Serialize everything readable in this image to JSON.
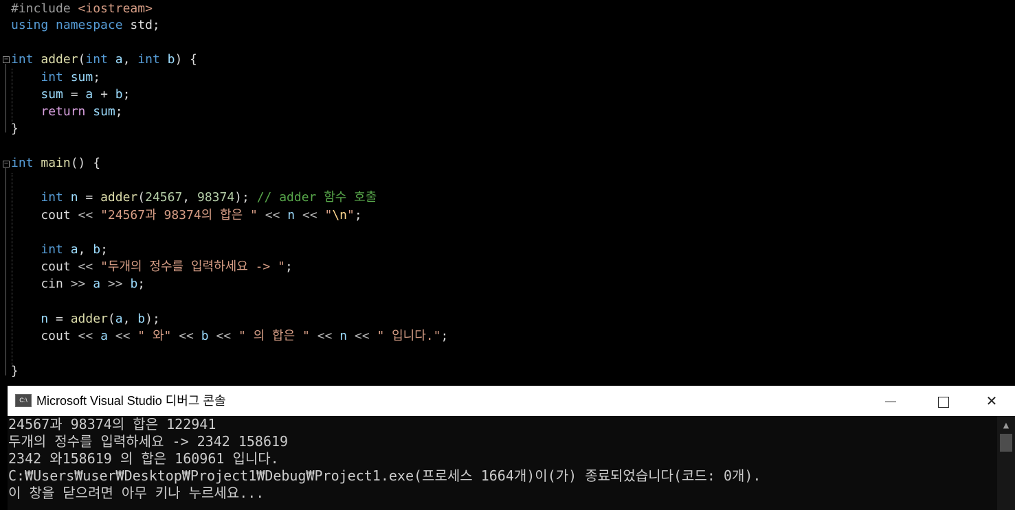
{
  "editor": {
    "lines": [
      [
        {
          "c": "tk-pre",
          "t": "#include "
        },
        {
          "c": "tk-str",
          "t": "<iostream>"
        }
      ],
      [
        {
          "c": "tk-kw",
          "t": "using"
        },
        {
          "c": "tk-txt",
          "t": " "
        },
        {
          "c": "tk-kw",
          "t": "namespace"
        },
        {
          "c": "tk-txt",
          "t": " std;"
        }
      ],
      [],
      [
        {
          "c": "tk-kw",
          "t": "int"
        },
        {
          "c": "tk-txt",
          "t": " "
        },
        {
          "c": "tk-fn",
          "t": "adder"
        },
        {
          "c": "tk-txt",
          "t": "("
        },
        {
          "c": "tk-kw",
          "t": "int"
        },
        {
          "c": "tk-txt",
          "t": " "
        },
        {
          "c": "tk-par",
          "t": "a"
        },
        {
          "c": "tk-txt",
          "t": ", "
        },
        {
          "c": "tk-kw",
          "t": "int"
        },
        {
          "c": "tk-txt",
          "t": " "
        },
        {
          "c": "tk-par",
          "t": "b"
        },
        {
          "c": "tk-txt",
          "t": ") {"
        }
      ],
      [
        {
          "c": "tk-txt",
          "t": "    "
        },
        {
          "c": "tk-kw",
          "t": "int"
        },
        {
          "c": "tk-txt",
          "t": " "
        },
        {
          "c": "tk-var",
          "t": "sum"
        },
        {
          "c": "tk-txt",
          "t": ";"
        }
      ],
      [
        {
          "c": "tk-txt",
          "t": "    "
        },
        {
          "c": "tk-var",
          "t": "sum"
        },
        {
          "c": "tk-txt",
          "t": " = "
        },
        {
          "c": "tk-par",
          "t": "a"
        },
        {
          "c": "tk-txt",
          "t": " + "
        },
        {
          "c": "tk-par",
          "t": "b"
        },
        {
          "c": "tk-txt",
          "t": ";"
        }
      ],
      [
        {
          "c": "tk-txt",
          "t": "    "
        },
        {
          "c": "tk-ctl",
          "t": "return"
        },
        {
          "c": "tk-txt",
          "t": " "
        },
        {
          "c": "tk-var",
          "t": "sum"
        },
        {
          "c": "tk-txt",
          "t": ";"
        }
      ],
      [
        {
          "c": "tk-txt",
          "t": "}"
        }
      ],
      [],
      [
        {
          "c": "tk-kw",
          "t": "int"
        },
        {
          "c": "tk-txt",
          "t": " "
        },
        {
          "c": "tk-fn",
          "t": "main"
        },
        {
          "c": "tk-txt",
          "t": "() {"
        }
      ],
      [],
      [
        {
          "c": "tk-txt",
          "t": "    "
        },
        {
          "c": "tk-kw",
          "t": "int"
        },
        {
          "c": "tk-txt",
          "t": " "
        },
        {
          "c": "tk-var",
          "t": "n"
        },
        {
          "c": "tk-txt",
          "t": " = "
        },
        {
          "c": "tk-fn",
          "t": "adder"
        },
        {
          "c": "tk-txt",
          "t": "("
        },
        {
          "c": "tk-num",
          "t": "24567"
        },
        {
          "c": "tk-txt",
          "t": ", "
        },
        {
          "c": "tk-num",
          "t": "98374"
        },
        {
          "c": "tk-txt",
          "t": "); "
        },
        {
          "c": "tk-cmt",
          "t": "// adder 함수 호출"
        }
      ],
      [
        {
          "c": "tk-txt",
          "t": "    cout "
        },
        {
          "c": "tk-op",
          "t": "<<"
        },
        {
          "c": "tk-txt",
          "t": " "
        },
        {
          "c": "tk-str",
          "t": "\"24567과 98374의 합은 \""
        },
        {
          "c": "tk-txt",
          "t": " "
        },
        {
          "c": "tk-op",
          "t": "<<"
        },
        {
          "c": "tk-txt",
          "t": " "
        },
        {
          "c": "tk-var",
          "t": "n"
        },
        {
          "c": "tk-txt",
          "t": " "
        },
        {
          "c": "tk-op",
          "t": "<<"
        },
        {
          "c": "tk-txt",
          "t": " "
        },
        {
          "c": "tk-str",
          "t": "\""
        },
        {
          "c": "tk-esc",
          "t": "\\n"
        },
        {
          "c": "tk-str",
          "t": "\""
        },
        {
          "c": "tk-txt",
          "t": ";"
        }
      ],
      [],
      [
        {
          "c": "tk-txt",
          "t": "    "
        },
        {
          "c": "tk-kw",
          "t": "int"
        },
        {
          "c": "tk-txt",
          "t": " "
        },
        {
          "c": "tk-var",
          "t": "a"
        },
        {
          "c": "tk-txt",
          "t": ", "
        },
        {
          "c": "tk-var",
          "t": "b"
        },
        {
          "c": "tk-txt",
          "t": ";"
        }
      ],
      [
        {
          "c": "tk-txt",
          "t": "    cout "
        },
        {
          "c": "tk-op",
          "t": "<<"
        },
        {
          "c": "tk-txt",
          "t": " "
        },
        {
          "c": "tk-str",
          "t": "\"두개의 정수를 입력하세요 -> \""
        },
        {
          "c": "tk-txt",
          "t": ";"
        }
      ],
      [
        {
          "c": "tk-txt",
          "t": "    cin "
        },
        {
          "c": "tk-op",
          "t": ">>"
        },
        {
          "c": "tk-txt",
          "t": " "
        },
        {
          "c": "tk-var",
          "t": "a"
        },
        {
          "c": "tk-txt",
          "t": " "
        },
        {
          "c": "tk-op",
          "t": ">>"
        },
        {
          "c": "tk-txt",
          "t": " "
        },
        {
          "c": "tk-var",
          "t": "b"
        },
        {
          "c": "tk-txt",
          "t": ";"
        }
      ],
      [],
      [
        {
          "c": "tk-txt",
          "t": "    "
        },
        {
          "c": "tk-var",
          "t": "n"
        },
        {
          "c": "tk-txt",
          "t": " = "
        },
        {
          "c": "tk-fn",
          "t": "adder"
        },
        {
          "c": "tk-txt",
          "t": "("
        },
        {
          "c": "tk-var",
          "t": "a"
        },
        {
          "c": "tk-txt",
          "t": ", "
        },
        {
          "c": "tk-var",
          "t": "b"
        },
        {
          "c": "tk-txt",
          "t": ");"
        }
      ],
      [
        {
          "c": "tk-txt",
          "t": "    cout "
        },
        {
          "c": "tk-op",
          "t": "<<"
        },
        {
          "c": "tk-txt",
          "t": " "
        },
        {
          "c": "tk-var",
          "t": "a"
        },
        {
          "c": "tk-txt",
          "t": " "
        },
        {
          "c": "tk-op",
          "t": "<<"
        },
        {
          "c": "tk-txt",
          "t": " "
        },
        {
          "c": "tk-str",
          "t": "\" 와\""
        },
        {
          "c": "tk-txt",
          "t": " "
        },
        {
          "c": "tk-op",
          "t": "<<"
        },
        {
          "c": "tk-txt",
          "t": " "
        },
        {
          "c": "tk-var",
          "t": "b"
        },
        {
          "c": "tk-txt",
          "t": " "
        },
        {
          "c": "tk-op",
          "t": "<<"
        },
        {
          "c": "tk-txt",
          "t": " "
        },
        {
          "c": "tk-str",
          "t": "\" 의 합은 \""
        },
        {
          "c": "tk-txt",
          "t": " "
        },
        {
          "c": "tk-op",
          "t": "<<"
        },
        {
          "c": "tk-txt",
          "t": " "
        },
        {
          "c": "tk-var",
          "t": "n"
        },
        {
          "c": "tk-txt",
          "t": " "
        },
        {
          "c": "tk-op",
          "t": "<<"
        },
        {
          "c": "tk-txt",
          "t": " "
        },
        {
          "c": "tk-str",
          "t": "\" 입니다.\""
        },
        {
          "c": "tk-txt",
          "t": ";"
        }
      ],
      [],
      [
        {
          "c": "tk-txt",
          "t": "}"
        }
      ]
    ]
  },
  "console": {
    "title": "Microsoft Visual Studio 디버그 콘솔",
    "icon": "console-app-icon",
    "controls": {
      "minimize": "minimize-icon",
      "maximize": "maximize-icon",
      "close": "close-icon"
    },
    "output": [
      "24567과 98374의 합은 122941",
      "두개의 정수를 입력하세요 -> 2342 158619",
      "2342 와158619 의 합은 160961 입니다.",
      "C:₩Users₩user₩Desktop₩Project1₩Debug₩Project1.exe(프로세스 1664개)이(가) 종료되었습니다(코드: 0개).",
      "이 창을 닫으려면 아무 키나 누르세요..."
    ]
  }
}
